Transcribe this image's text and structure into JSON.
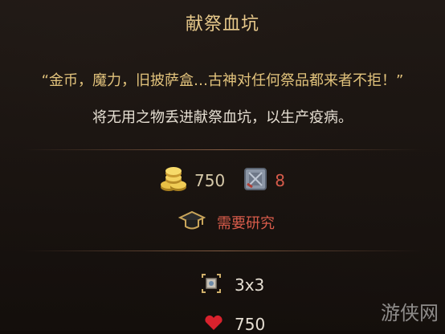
{
  "tooltip": {
    "title": "献祭血坑",
    "quote": "“金币，魔力，旧披萨盒…古神对任何祭品都来者不拒！”",
    "description": "将无用之物丢进献祭血坑，以生产疫病。",
    "costs": {
      "gold": {
        "icon": "gold-coins-icon",
        "value": "750"
      },
      "crate": {
        "icon": "crate-icon",
        "value": "8"
      }
    },
    "research": {
      "icon": "graduation-cap-icon",
      "label": "需要研究"
    },
    "size": {
      "icon": "room-size-icon",
      "value": "3x3"
    },
    "health": {
      "icon": "heart-icon",
      "value": "750"
    }
  },
  "watermark": "游侠网",
  "colors": {
    "title": "#e7c98b",
    "quote": "#e2c37c",
    "warning": "#d65b4a",
    "text": "#e6dfd3"
  }
}
